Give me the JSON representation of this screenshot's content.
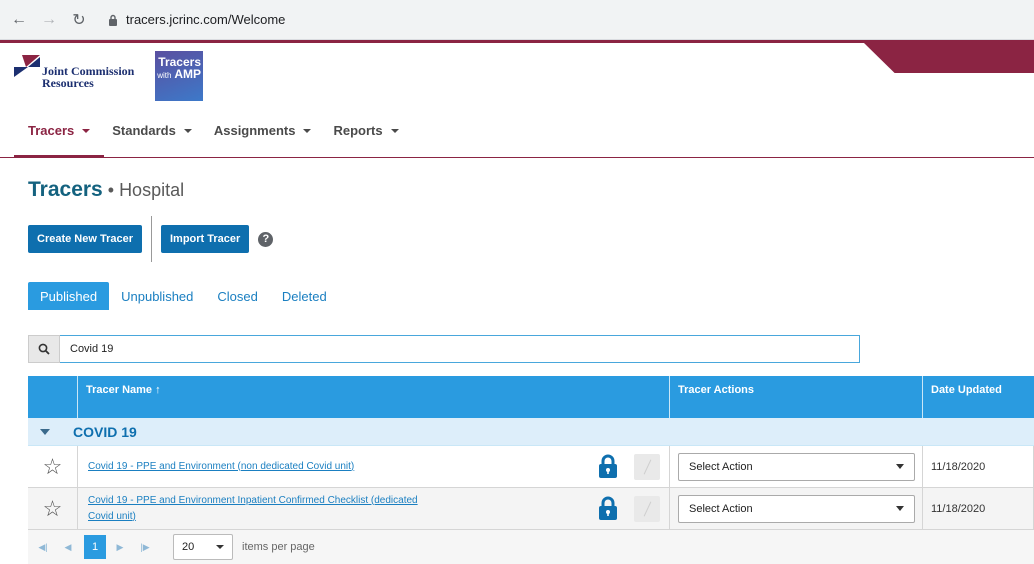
{
  "browser": {
    "url": "tracers.jcrinc.com/Welcome"
  },
  "brand": {
    "jc_line1": "Joint Commission",
    "jc_line2": "Resources",
    "amp_line1": "Tracers",
    "amp_prefix": "with",
    "amp_line2": "AMP"
  },
  "nav": {
    "items": [
      {
        "label": "Tracers"
      },
      {
        "label": "Standards"
      },
      {
        "label": "Assignments"
      },
      {
        "label": "Reports"
      }
    ]
  },
  "page": {
    "title": "Tracers",
    "separator": "•",
    "subtitle": "Hospital"
  },
  "buttons": {
    "create": "Create New Tracer",
    "import": "Import Tracer",
    "help": "?"
  },
  "tabs": [
    {
      "label": "Published"
    },
    {
      "label": "Unpublished"
    },
    {
      "label": "Closed"
    },
    {
      "label": "Deleted"
    }
  ],
  "search": {
    "value": "Covid 19"
  },
  "table": {
    "columns": {
      "name": "Tracer Name",
      "sort_arrow": "↑",
      "actions": "Tracer Actions",
      "date": "Date Updated"
    },
    "group": "COVID 19",
    "rows": [
      {
        "name": "Covid 19 - PPE and Environment (non dedicated Covid unit)",
        "action": "Select Action",
        "date": "11/18/2020"
      },
      {
        "name": "Covid 19 - PPE and Environment Inpatient Confirmed Checklist (dedicated Covid unit)",
        "action": "Select Action",
        "date": "11/18/2020"
      }
    ]
  },
  "pager": {
    "page": "1",
    "per_page": "20",
    "per_page_label": "items per page"
  },
  "colors": {
    "brand_maroon": "#8b2443",
    "primary_blue": "#0e6fae",
    "header_blue": "#2a9be0",
    "title_teal": "#14627f"
  }
}
